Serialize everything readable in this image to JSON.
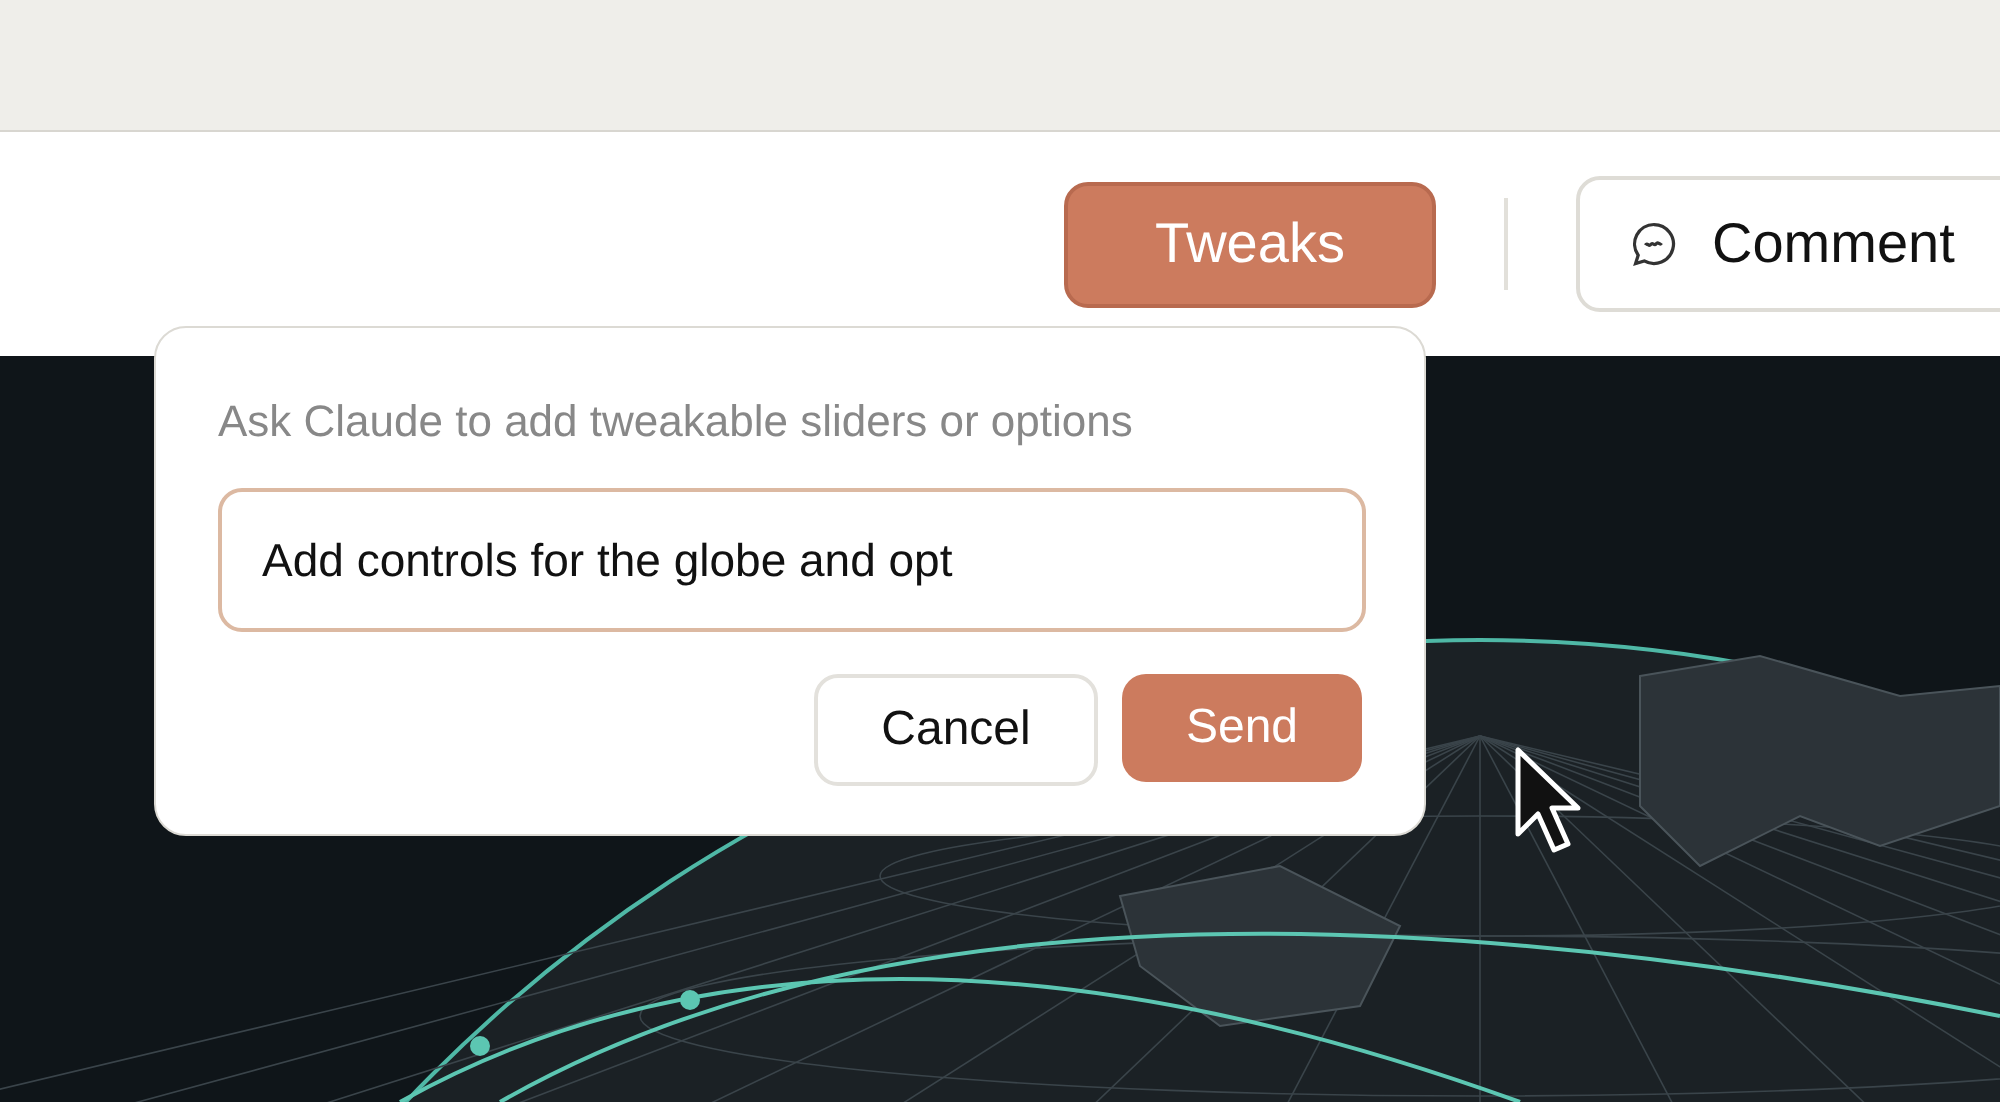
{
  "toolbar": [
    {
      "kind": "tweaks",
      "label": "Tweaks",
      "selected": true
    },
    {
      "kind": "comment",
      "label": "Comment",
      "selected": false
    }
  ],
  "popover": {
    "prompt": "Ask Claude to add tweakable sliders or options",
    "input": {
      "value": "Add controls for the globe and opt"
    },
    "buttons": [
      {
        "kind": "secondary",
        "label": "Cancel"
      },
      {
        "kind": "primary",
        "label": "Send"
      }
    ]
  }
}
